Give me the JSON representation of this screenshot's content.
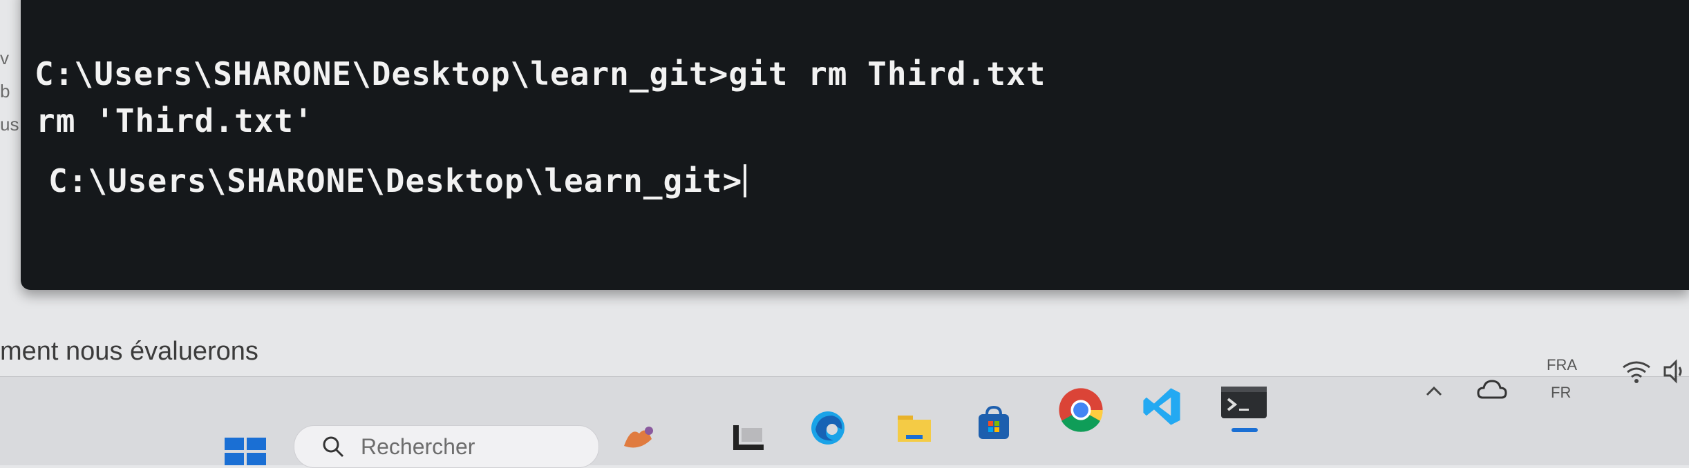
{
  "background": {
    "left_edge_fragments": [
      "v",
      "b",
      "us"
    ],
    "document_text": "ment nous évaluerons"
  },
  "terminal": {
    "lines": [
      "C:\\Users\\SHARONE\\Desktop\\learn_git>git rm Third.txt",
      "rm 'Third.txt'",
      "C:\\Users\\SHARONE\\Desktop\\learn_git>"
    ],
    "colors": {
      "background": "#15181b",
      "text": "#f2f2f2"
    }
  },
  "taskbar": {
    "start_icon": "windows-start-icon",
    "search": {
      "icon": "search-icon",
      "placeholder": "Rechercher"
    },
    "apps": [
      {
        "name": "widgets-icon"
      },
      {
        "name": "task-view-icon"
      },
      {
        "name": "edge-icon"
      },
      {
        "name": "file-explorer-icon"
      },
      {
        "name": "microsoft-store-icon"
      },
      {
        "name": "chrome-icon"
      },
      {
        "name": "vscode-icon"
      },
      {
        "name": "terminal-icon",
        "active": true
      }
    ],
    "tray": {
      "chevron_icon": "chevron-up-icon",
      "onedrive_icon": "cloud-icon",
      "language_top": "FRA",
      "language_bottom": "FR",
      "wifi_icon": "wifi-icon",
      "volume_icon": "volume-icon"
    },
    "colors": {
      "accent": "#1a6fd4"
    }
  }
}
